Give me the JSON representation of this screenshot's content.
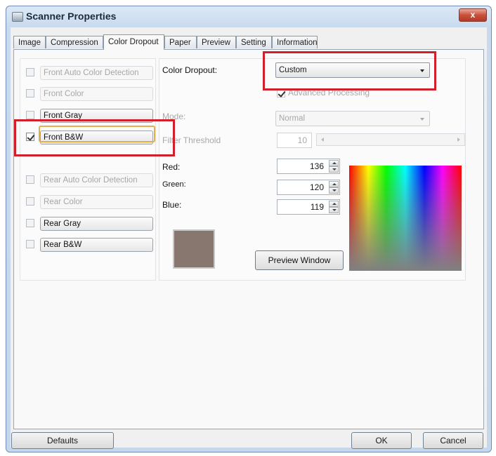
{
  "window": {
    "title": "Scanner Properties",
    "close_label": "x"
  },
  "tabs": [
    "Image",
    "Compression",
    "Color Dropout",
    "Paper",
    "Preview",
    "Setting",
    "Information"
  ],
  "active_tab": "Color Dropout",
  "left_options": [
    {
      "label": "Front Auto Color Detection",
      "checked": false,
      "enabled": false
    },
    {
      "label": "Front Color",
      "checked": false,
      "enabled": false
    },
    {
      "label": "Front Gray",
      "checked": false,
      "enabled": true
    },
    {
      "label": "Front B&W",
      "checked": true,
      "enabled": true
    },
    {
      "label": "Rear Auto Color Detection",
      "checked": false,
      "enabled": false
    },
    {
      "label": "Rear Color",
      "checked": false,
      "enabled": false
    },
    {
      "label": "Rear Gray",
      "checked": false,
      "enabled": true
    },
    {
      "label": "Rear B&W",
      "checked": false,
      "enabled": true
    }
  ],
  "color_dropout": {
    "label": "Color Dropout:",
    "value": "Custom"
  },
  "advanced_processing": {
    "label": "Advanced Processing",
    "checked": true,
    "enabled": false
  },
  "mode": {
    "label": "Mode:",
    "value": "Normal"
  },
  "filter_threshold": {
    "label": "Filter Threshold",
    "value": "10"
  },
  "rgb": {
    "red_label": "Red:",
    "red_value": "136",
    "green_label": "Green:",
    "green_value": "120",
    "blue_label": "Blue:",
    "blue_value": "119"
  },
  "swatch_color": "#88776f",
  "preview_window_button": "Preview Window",
  "footer": {
    "defaults": "Defaults",
    "ok": "OK",
    "cancel": "Cancel"
  },
  "highlight_color": "#d0202b"
}
